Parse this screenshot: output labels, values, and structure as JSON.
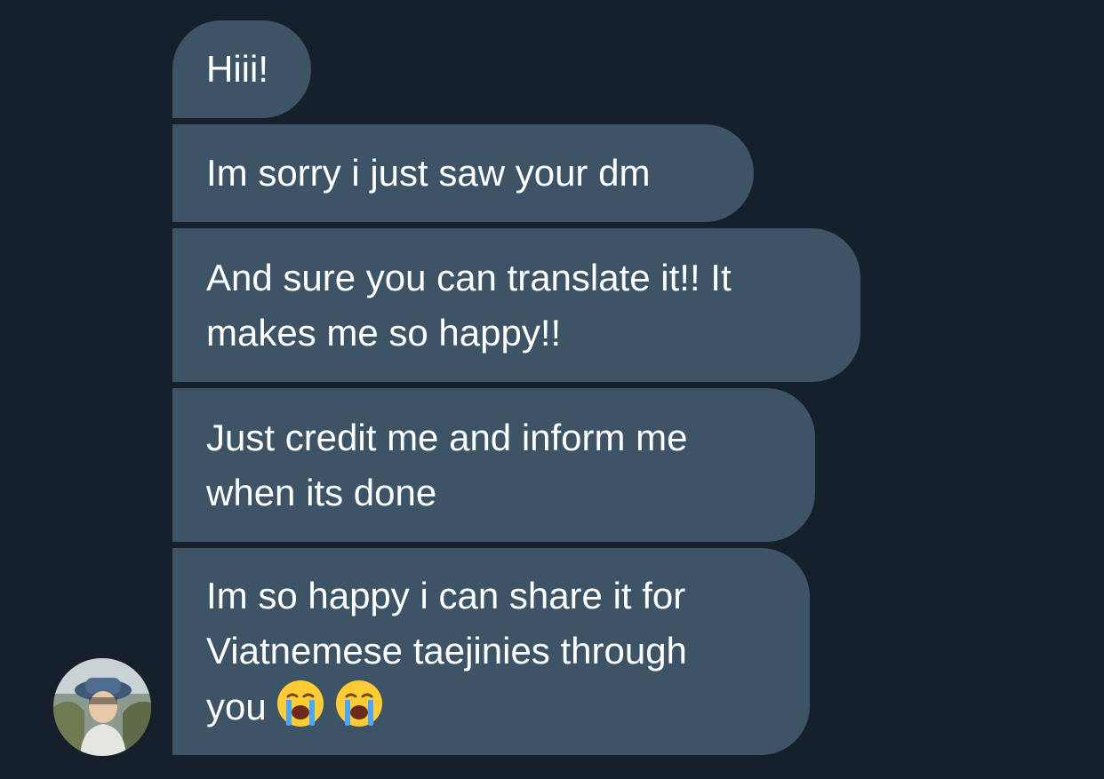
{
  "messages": [
    {
      "text": "Hiii!"
    },
    {
      "text": "Im sorry i just saw your dm"
    },
    {
      "text": "And sure you can translate it!! It\nmakes me so happy!!"
    },
    {
      "text": "Just credit me and inform me\nwhen its done"
    },
    {
      "text": "Im so happy i can share it for\nViatnemese taejinies through\nyou",
      "emojis": [
        "loudly-crying-face",
        "loudly-crying-face"
      ]
    }
  ],
  "timestamp": "",
  "colors": {
    "background": "#15202b",
    "bubble": "#3d5466",
    "text": "#ffffff"
  },
  "icons": {
    "emoji": "loudly-crying-face",
    "avatar": "user-avatar"
  }
}
